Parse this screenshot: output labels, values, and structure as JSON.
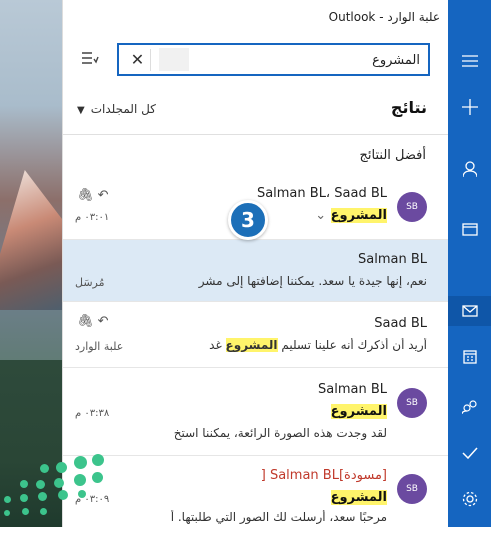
{
  "window_title": "علبة الوارد - Outlook",
  "search": {
    "value": "المشروع"
  },
  "header": {
    "results_label": "نتائج",
    "folders_label": "كل المجلدات"
  },
  "best_results_label": "أفضل النتائج",
  "step_badge": "3",
  "emails": [
    {
      "sender": "Salman BL، Saad BL",
      "subject": "المشروع",
      "time": "٠٣:٠١ م",
      "avatar": "SB"
    },
    {
      "sender": "Salman BL",
      "preview": "نعم، إنها جيدة يا سعد. يمكننا إضافتها إلى مشر",
      "folder": "مُرسَل"
    },
    {
      "sender": "Saad BL",
      "preview_before": "أريد أن أذكرك أنه علينا تسليم ",
      "preview_highlight": "المشروع",
      "preview_after": " غد",
      "folder": "علبة الوارد"
    },
    {
      "sender": "Salman BL",
      "subject": "المشروع",
      "preview": "لقد وجدت هذه الصورة الرائعة، يمكننا استخ",
      "time": "٠٣:٣٨ م",
      "avatar": "SB"
    },
    {
      "draft_label": "[مسودة]",
      "sender": "Salman BL [",
      "subject": "المشروع",
      "preview": "مرحبًا سعد، أرسلت لك الصور التي طلبتها. أ",
      "time": "٠٣:٠٩ م",
      "avatar": "SB"
    }
  ],
  "rail_icons": [
    "hamburger-icon",
    "plus-icon",
    "person-icon",
    "folder-icon",
    "mail-icon",
    "calendar-icon",
    "people-icon",
    "todo-check-icon",
    "settings-gear-icon"
  ],
  "colors": {
    "rail": "#1565c0",
    "highlight": "#fff46b",
    "avatar": "#6b4aa0",
    "selected_row": "#dce9f5",
    "badge": "#1c6fb8"
  }
}
